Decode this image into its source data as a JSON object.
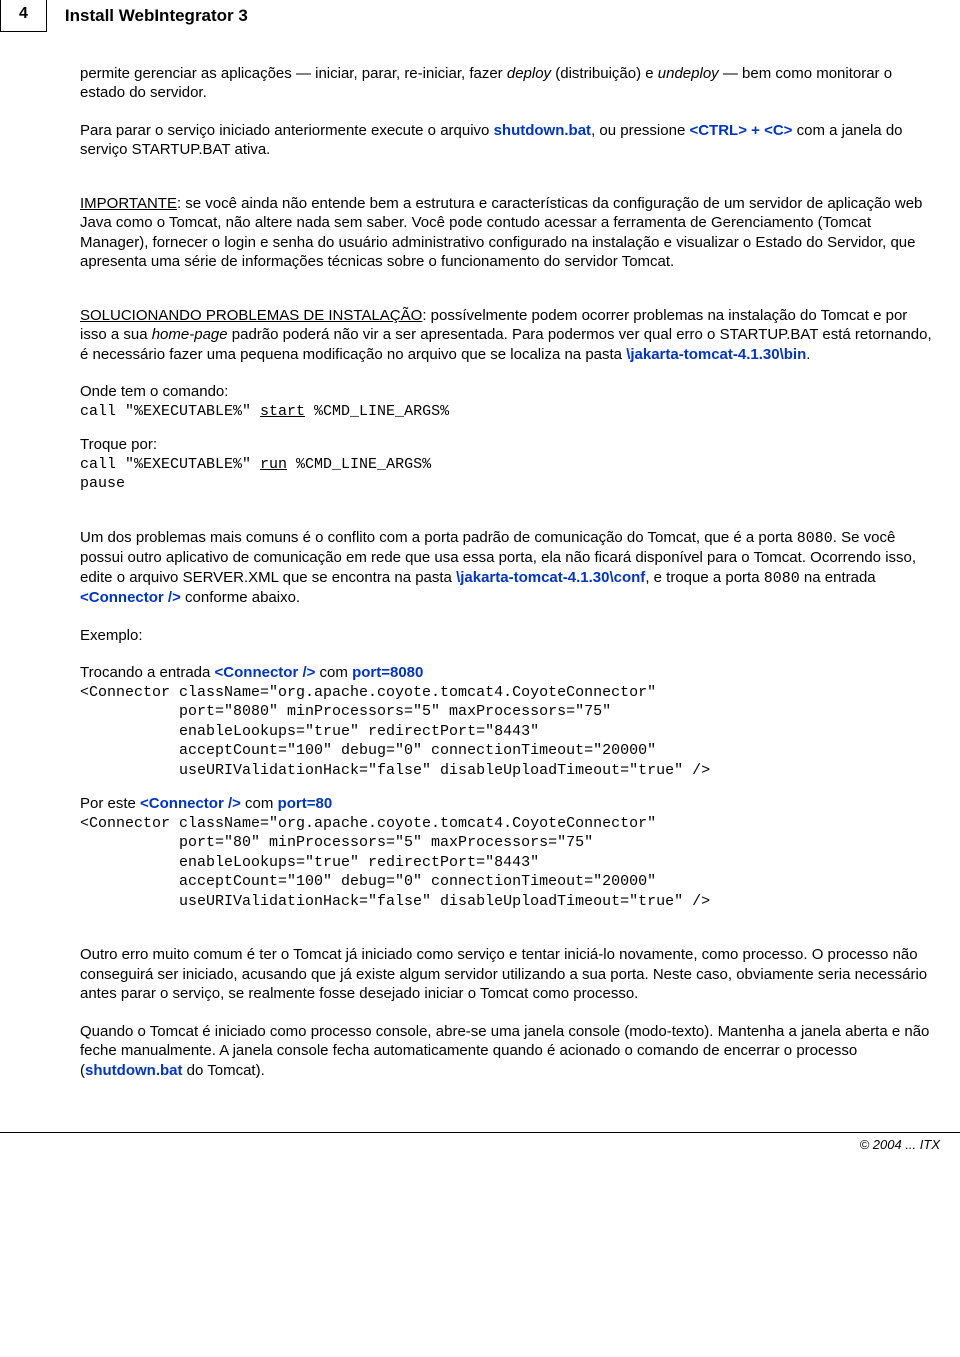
{
  "header": {
    "pageNumber": "4",
    "title": "Install WebIntegrator 3"
  },
  "body": {
    "p1_a": "permite gerenciar as aplicações — iniciar, parar, re-iniciar, fazer ",
    "p1_deploy": "deploy",
    "p1_b": " (distribuição) e ",
    "p1_undeploy": "undeploy",
    "p1_c": " — bem como monitorar o estado do servidor.",
    "p2_a": "Para parar o serviço iniciado anteriormente execute o arquivo ",
    "p2_shutdown": "shutdown.bat",
    "p2_b": ", ou pressione ",
    "p2_ctrl": "<CTRL> + <C>",
    "p2_c": " com a janela do serviço STARTUP.BAT ativa.",
    "p3_label": "IMPORTANTE",
    "p3_rest": ": se você ainda não entende bem a estrutura e características da configuração de um servidor de aplicação web Java como o Tomcat, não altere nada sem saber. Você pode contudo acessar a ferramenta de Gerenciamento (Tomcat Manager), fornecer o login e senha do usuário administrativo configurado na instalação e visualizar o Estado do Servidor, que apresenta uma série de informações técnicas sobre o funcionamento do servidor Tomcat.",
    "p4_label": "SOLUCIONANDO PROBLEMAS DE INSTALAÇÃO",
    "p4_a": ": possívelmente podem ocorrer problemas na instalação do Tomcat e por isso a sua ",
    "p4_home": "home-page",
    "p4_b": " padrão poderá não vir a ser apresentada. Para podermos ver qual erro o STARTUP.BAT está retornando, é necessário fazer uma pequena modificação no arquivo que se localiza na pasta ",
    "p4_path": "\\jakarta-tomcat-4.1.30\\bin",
    "p4_c": ".",
    "p5": "Onde tem o comando:",
    "code1_a": "call \"%EXECUTABLE%\" ",
    "code1_u": "start",
    "code1_b": " %CMD_LINE_ARGS%",
    "p6": "Troque por:",
    "code2_a": "call \"%EXECUTABLE%\" ",
    "code2_u": "run",
    "code2_b": " %CMD_LINE_ARGS%",
    "code2_c": "pause",
    "p7_a": "Um dos problemas mais comuns é o conflito com a porta padrão de comunicação do Tomcat, que é a porta ",
    "p7_port": "8080",
    "p7_b": ". Se você possui outro aplicativo de comunicação em rede que usa essa porta, ela não ficará disponível para o Tomcat. Ocorrendo isso, edite o arquivo SERVER.XML que se encontra na pasta ",
    "p7_path": "\\jakarta-tomcat-4.1.30\\conf",
    "p7_c": ", e troque a porta ",
    "p7_port2": "8080",
    "p7_d": " na entrada ",
    "p7_conn": "<Connector />",
    "p7_e": " conforme abaixo.",
    "p8": "Exemplo:",
    "p9_a": "Trocando a entrada ",
    "p9_conn": "<Connector />",
    "p9_b": " com ",
    "p9_port": "port=8080",
    "code3": "<Connector className=\"org.apache.coyote.tomcat4.CoyoteConnector\"\n           port=\"8080\" minProcessors=\"5\" maxProcessors=\"75\"\n           enableLookups=\"true\" redirectPort=\"8443\"\n           acceptCount=\"100\" debug=\"0\" connectionTimeout=\"20000\"\n           useURIValidationHack=\"false\" disableUploadTimeout=\"true\" />",
    "p10_a": "Por este ",
    "p10_conn": "<Connector />",
    "p10_b": " com ",
    "p10_port": "port=80",
    "code4": "<Connector className=\"org.apache.coyote.tomcat4.CoyoteConnector\"\n           port=\"80\" minProcessors=\"5\" maxProcessors=\"75\"\n           enableLookups=\"true\" redirectPort=\"8443\"\n           acceptCount=\"100\" debug=\"0\" connectionTimeout=\"20000\"\n           useURIValidationHack=\"false\" disableUploadTimeout=\"true\" />",
    "p11": "Outro erro muito comum é ter o Tomcat já iniciado como serviço e tentar iniciá-lo novamente, como processo. O processo não conseguirá ser iniciado, acusando que já existe algum servidor utilizando a sua porta. Neste caso, obviamente seria necessário antes parar o serviço, se realmente fosse desejado iniciar o Tomcat como processo.",
    "p12_a": "Quando o Tomcat é iniciado como processo console, abre-se uma janela console (modo-texto). Mantenha a janela aberta e não feche manualmente. A janela console fecha automaticamente quando é acionado o comando de encerrar o processo (",
    "p12_shutdown": "shutdown.bat",
    "p12_b": " do Tomcat)."
  },
  "footer": {
    "copyright": "© 2004 ... ITX"
  }
}
